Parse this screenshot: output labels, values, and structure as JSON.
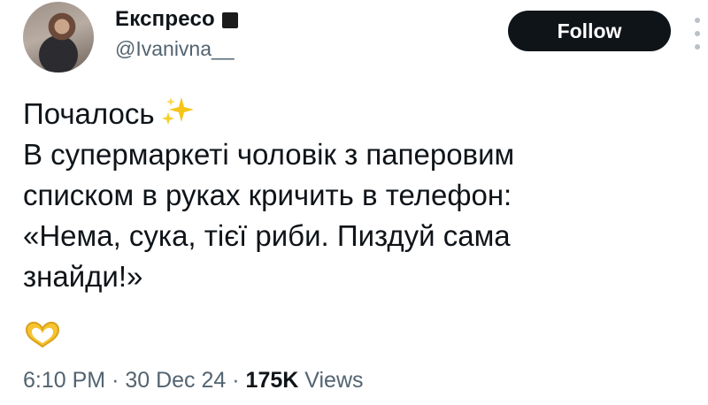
{
  "author": {
    "display_name": "Експресо",
    "handle": "@Ivanivna__",
    "badge_icon": "black-square-icon"
  },
  "follow_button": {
    "label": "Follow"
  },
  "tweet": {
    "lines": [
      "Почалось",
      "В супермаркеті чоловік з паперовим",
      "списком в руках кричить в телефон:",
      "«Нема, сука, тієї риби. Пиздуй сама",
      "знайди!»"
    ],
    "emojis": [
      "sparkles-icon",
      "heart-hands-icon"
    ]
  },
  "meta": {
    "time": "6:10 PM",
    "separator": "·",
    "date": "30 Dec 24",
    "views_count": "175K",
    "views_label": "Views"
  },
  "colors": {
    "text": "#0f1419",
    "secondary": "#536471",
    "button_bg": "#0f1419",
    "button_text": "#ffffff"
  }
}
